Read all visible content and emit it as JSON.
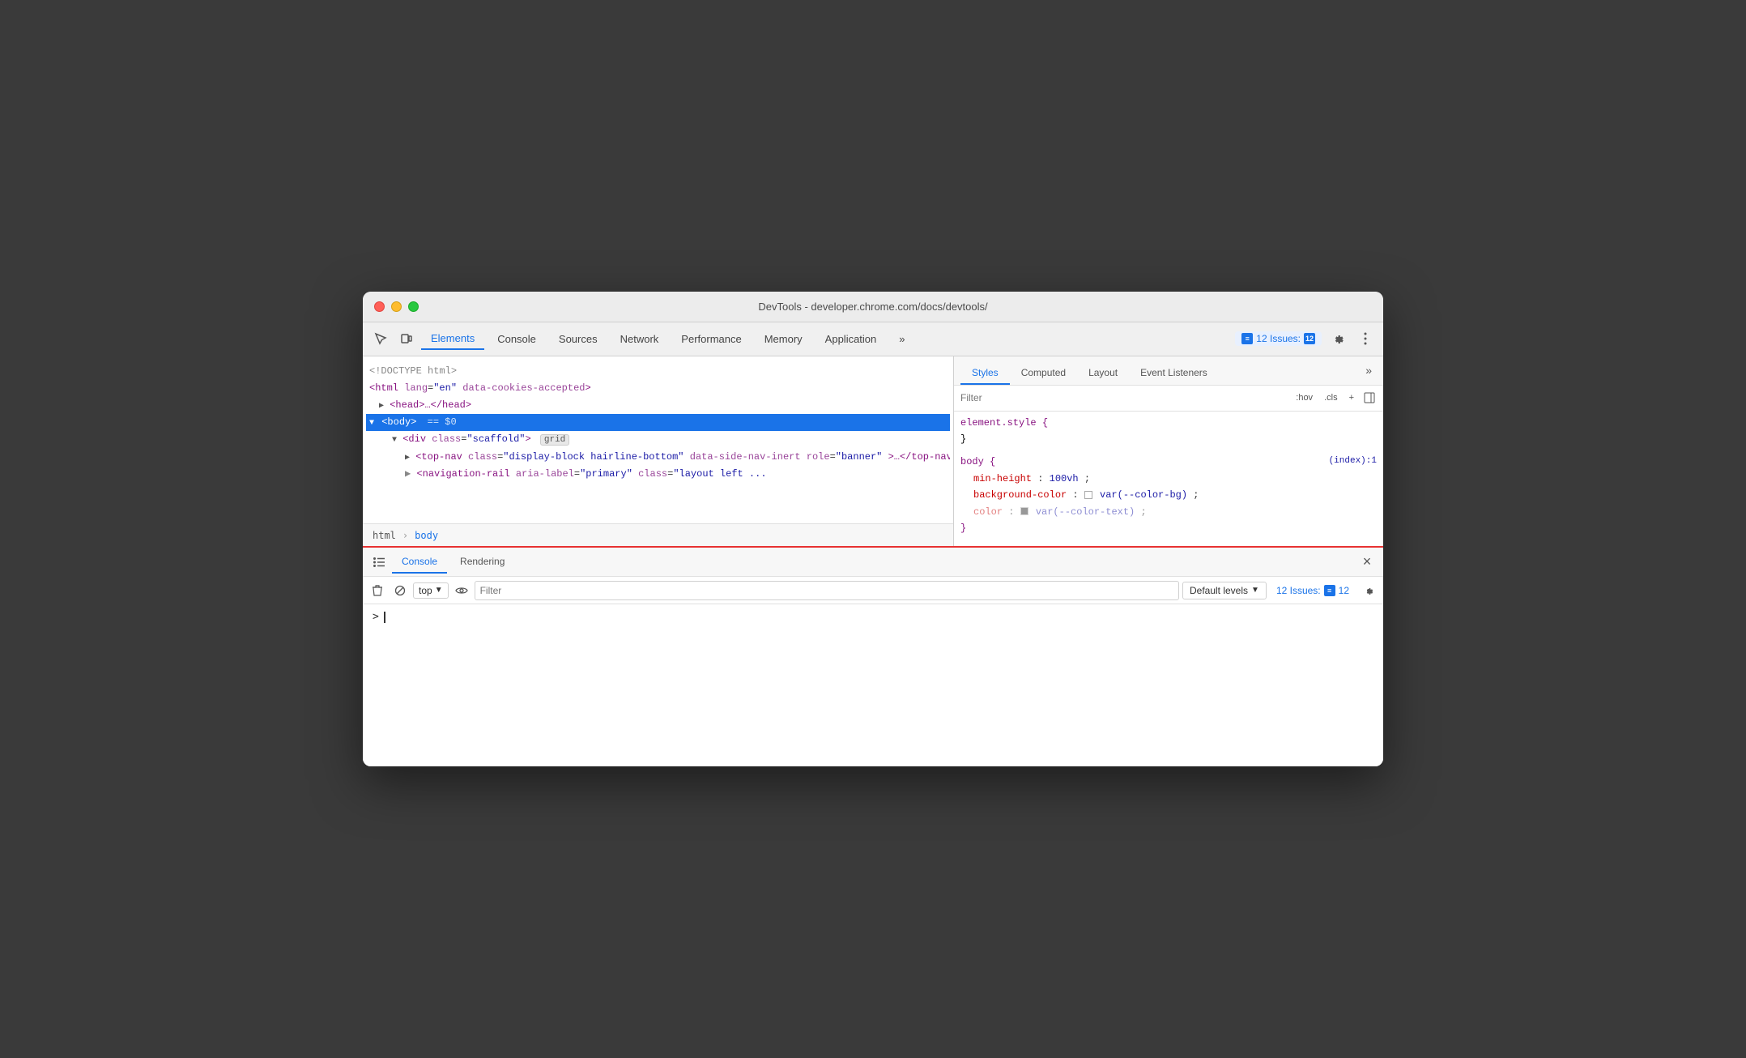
{
  "window": {
    "title": "DevTools - developer.chrome.com/docs/devtools/"
  },
  "toolbar": {
    "tabs": [
      {
        "label": "Elements",
        "active": true
      },
      {
        "label": "Console",
        "active": false
      },
      {
        "label": "Sources",
        "active": false
      },
      {
        "label": "Network",
        "active": false
      },
      {
        "label": "Performance",
        "active": false
      },
      {
        "label": "Memory",
        "active": false
      },
      {
        "label": "Application",
        "active": false
      }
    ],
    "more_label": "»",
    "issues_count": "12",
    "issues_label": "12 Issues: ",
    "settings_title": "Settings",
    "more_options_title": "More options"
  },
  "dom_tree": {
    "lines": [
      {
        "text": "<!DOCTYPE html>",
        "indent": 0
      },
      {
        "text": "",
        "indent": 0
      },
      {
        "text": "",
        "indent": 0
      },
      {
        "text": "",
        "indent": 0
      },
      {
        "text": "",
        "indent": 0
      }
    ],
    "doctype": "<!DOCTYPE html>",
    "html_open": "<html lang=\"en\" data-cookies-accepted>",
    "head": "▶ <head>…</head>",
    "body": "▼ <body> == $0",
    "div_scaffold": "<div class=\"scaffold\">",
    "badge_grid": "grid",
    "top_nav": "<top-nav class=\"display-block hairline-bottom\" data-side-nav-inert role=\"banner\">…</top-nav>",
    "nav_rail": "<navigation-rail aria-label=\"primary\" class=\"layout left ..."
  },
  "breadcrumb": {
    "items": [
      {
        "label": "html",
        "active": false
      },
      {
        "label": "body",
        "active": true
      }
    ]
  },
  "styles_panel": {
    "tabs": [
      {
        "label": "Styles",
        "active": true
      },
      {
        "label": "Computed",
        "active": false
      },
      {
        "label": "Layout",
        "active": false
      },
      {
        "label": "Event Listeners",
        "active": false
      }
    ],
    "more_label": "»",
    "filter_placeholder": "Filter",
    "hov_label": ":hov",
    "cls_label": ".cls",
    "plus_label": "+",
    "element_style_header": "element.style {",
    "element_style_close": "}",
    "body_rule_header": "body {",
    "body_rule_close": "}",
    "body_source": "(index):1",
    "props": [
      {
        "name": "min-height",
        "sep": ": ",
        "value": "100vh",
        "end": ";"
      },
      {
        "name": "background-color",
        "sep": ": ",
        "value": "var(--color-bg)",
        "end": ";",
        "has_swatch": true,
        "swatch_color": "#ffffff"
      },
      {
        "name": "color",
        "sep": ": ",
        "value": "var(--color-text)",
        "end": ";",
        "has_swatch": true,
        "swatch_color": "#333333",
        "faded": true
      }
    ]
  },
  "console_drawer": {
    "tabs": [
      {
        "label": "Console",
        "active": true
      },
      {
        "label": "Rendering",
        "active": false
      }
    ],
    "close_label": "×",
    "top_label": "top",
    "filter_placeholder": "Filter",
    "default_levels_label": "Default levels",
    "issues_count_label": "12 Issues: ",
    "issues_num": "12"
  }
}
